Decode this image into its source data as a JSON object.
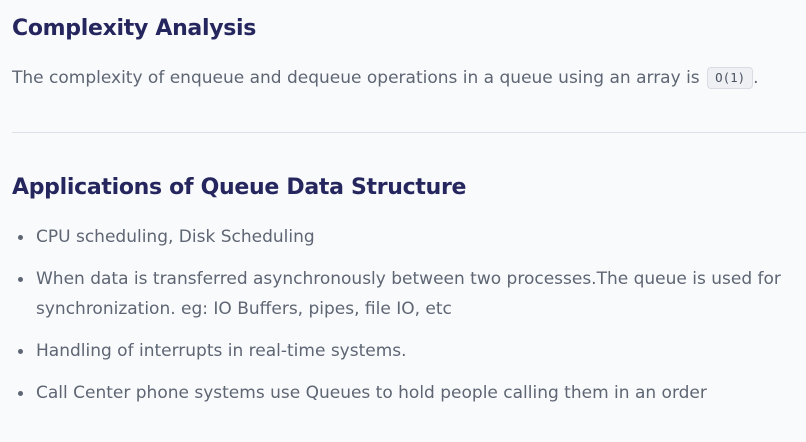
{
  "complexity": {
    "heading": "Complexity Analysis",
    "text": "The complexity of enqueue and dequeue operations in a queue using an array is",
    "code": "O(1)",
    "trailing": "."
  },
  "applications": {
    "heading": "Applications of Queue Data Structure",
    "items": [
      "CPU scheduling, Disk Scheduling",
      "When data is transferred asynchronously between two processes.The queue is used for synchronization. eg: IO Buffers, pipes, file IO, etc",
      "Handling of interrupts in real-time systems.",
      "Call Center phone systems use Queues to hold people calling them in an order"
    ]
  }
}
